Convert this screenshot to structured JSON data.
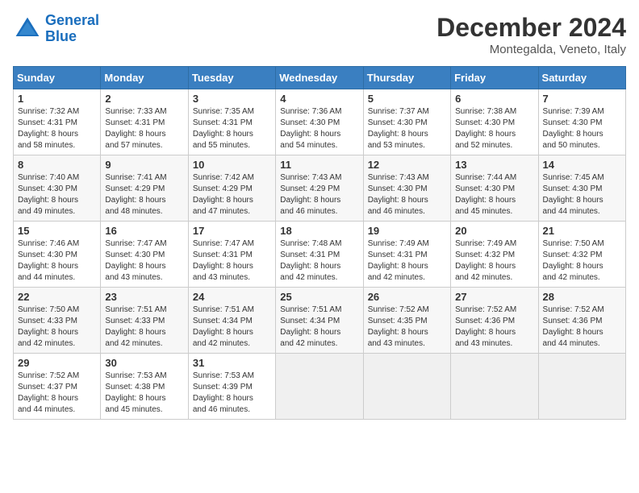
{
  "header": {
    "logo_line1": "General",
    "logo_line2": "Blue",
    "month": "December 2024",
    "location": "Montegalda, Veneto, Italy"
  },
  "weekdays": [
    "Sunday",
    "Monday",
    "Tuesday",
    "Wednesday",
    "Thursday",
    "Friday",
    "Saturday"
  ],
  "weeks": [
    [
      {
        "day": "1",
        "info": "Sunrise: 7:32 AM\nSunset: 4:31 PM\nDaylight: 8 hours\nand 58 minutes."
      },
      {
        "day": "2",
        "info": "Sunrise: 7:33 AM\nSunset: 4:31 PM\nDaylight: 8 hours\nand 57 minutes."
      },
      {
        "day": "3",
        "info": "Sunrise: 7:35 AM\nSunset: 4:31 PM\nDaylight: 8 hours\nand 55 minutes."
      },
      {
        "day": "4",
        "info": "Sunrise: 7:36 AM\nSunset: 4:30 PM\nDaylight: 8 hours\nand 54 minutes."
      },
      {
        "day": "5",
        "info": "Sunrise: 7:37 AM\nSunset: 4:30 PM\nDaylight: 8 hours\nand 53 minutes."
      },
      {
        "day": "6",
        "info": "Sunrise: 7:38 AM\nSunset: 4:30 PM\nDaylight: 8 hours\nand 52 minutes."
      },
      {
        "day": "7",
        "info": "Sunrise: 7:39 AM\nSunset: 4:30 PM\nDaylight: 8 hours\nand 50 minutes."
      }
    ],
    [
      {
        "day": "8",
        "info": "Sunrise: 7:40 AM\nSunset: 4:30 PM\nDaylight: 8 hours\nand 49 minutes."
      },
      {
        "day": "9",
        "info": "Sunrise: 7:41 AM\nSunset: 4:29 PM\nDaylight: 8 hours\nand 48 minutes."
      },
      {
        "day": "10",
        "info": "Sunrise: 7:42 AM\nSunset: 4:29 PM\nDaylight: 8 hours\nand 47 minutes."
      },
      {
        "day": "11",
        "info": "Sunrise: 7:43 AM\nSunset: 4:29 PM\nDaylight: 8 hours\nand 46 minutes."
      },
      {
        "day": "12",
        "info": "Sunrise: 7:43 AM\nSunset: 4:30 PM\nDaylight: 8 hours\nand 46 minutes."
      },
      {
        "day": "13",
        "info": "Sunrise: 7:44 AM\nSunset: 4:30 PM\nDaylight: 8 hours\nand 45 minutes."
      },
      {
        "day": "14",
        "info": "Sunrise: 7:45 AM\nSunset: 4:30 PM\nDaylight: 8 hours\nand 44 minutes."
      }
    ],
    [
      {
        "day": "15",
        "info": "Sunrise: 7:46 AM\nSunset: 4:30 PM\nDaylight: 8 hours\nand 44 minutes."
      },
      {
        "day": "16",
        "info": "Sunrise: 7:47 AM\nSunset: 4:30 PM\nDaylight: 8 hours\nand 43 minutes."
      },
      {
        "day": "17",
        "info": "Sunrise: 7:47 AM\nSunset: 4:31 PM\nDaylight: 8 hours\nand 43 minutes."
      },
      {
        "day": "18",
        "info": "Sunrise: 7:48 AM\nSunset: 4:31 PM\nDaylight: 8 hours\nand 42 minutes."
      },
      {
        "day": "19",
        "info": "Sunrise: 7:49 AM\nSunset: 4:31 PM\nDaylight: 8 hours\nand 42 minutes."
      },
      {
        "day": "20",
        "info": "Sunrise: 7:49 AM\nSunset: 4:32 PM\nDaylight: 8 hours\nand 42 minutes."
      },
      {
        "day": "21",
        "info": "Sunrise: 7:50 AM\nSunset: 4:32 PM\nDaylight: 8 hours\nand 42 minutes."
      }
    ],
    [
      {
        "day": "22",
        "info": "Sunrise: 7:50 AM\nSunset: 4:33 PM\nDaylight: 8 hours\nand 42 minutes."
      },
      {
        "day": "23",
        "info": "Sunrise: 7:51 AM\nSunset: 4:33 PM\nDaylight: 8 hours\nand 42 minutes."
      },
      {
        "day": "24",
        "info": "Sunrise: 7:51 AM\nSunset: 4:34 PM\nDaylight: 8 hours\nand 42 minutes."
      },
      {
        "day": "25",
        "info": "Sunrise: 7:51 AM\nSunset: 4:34 PM\nDaylight: 8 hours\nand 42 minutes."
      },
      {
        "day": "26",
        "info": "Sunrise: 7:52 AM\nSunset: 4:35 PM\nDaylight: 8 hours\nand 43 minutes."
      },
      {
        "day": "27",
        "info": "Sunrise: 7:52 AM\nSunset: 4:36 PM\nDaylight: 8 hours\nand 43 minutes."
      },
      {
        "day": "28",
        "info": "Sunrise: 7:52 AM\nSunset: 4:36 PM\nDaylight: 8 hours\nand 44 minutes."
      }
    ],
    [
      {
        "day": "29",
        "info": "Sunrise: 7:52 AM\nSunset: 4:37 PM\nDaylight: 8 hours\nand 44 minutes."
      },
      {
        "day": "30",
        "info": "Sunrise: 7:53 AM\nSunset: 4:38 PM\nDaylight: 8 hours\nand 45 minutes."
      },
      {
        "day": "31",
        "info": "Sunrise: 7:53 AM\nSunset: 4:39 PM\nDaylight: 8 hours\nand 46 minutes."
      },
      null,
      null,
      null,
      null
    ]
  ]
}
